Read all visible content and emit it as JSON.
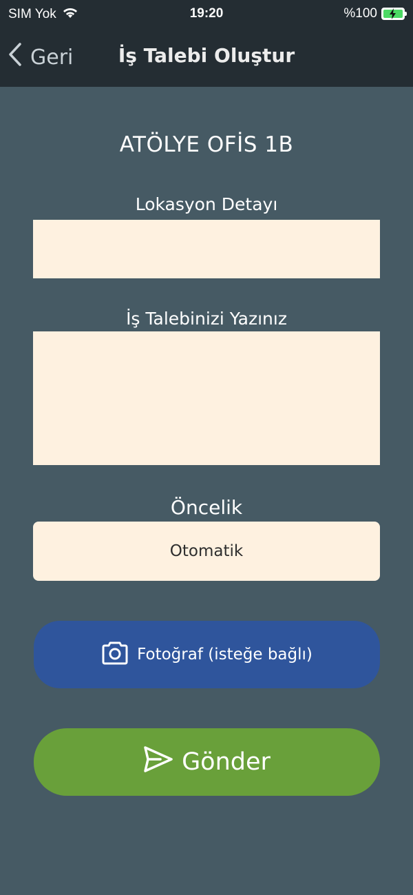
{
  "status_bar": {
    "carrier": "SIM Yok",
    "time": "19:20",
    "battery_text": "%100"
  },
  "nav": {
    "back_label": "Geri",
    "title": "İş Talebi Oluştur"
  },
  "form": {
    "location_name": "ATÖLYE OFİS 1B",
    "location_detail_label": "Lokasyon Detayı",
    "location_detail_value": "",
    "request_label": "İş Talebinizi Yazınız",
    "request_value": "",
    "priority_label": "Öncelik",
    "priority_value": "Otomatik"
  },
  "actions": {
    "photo_label": "Fotoğraf (isteğe bağlı)",
    "send_label": "Gönder"
  },
  "colors": {
    "header_bg": "#242d33",
    "page_bg": "#465a64",
    "field_bg": "#fef1e0",
    "photo_button": "#2f559c",
    "send_button": "#69a03a"
  }
}
